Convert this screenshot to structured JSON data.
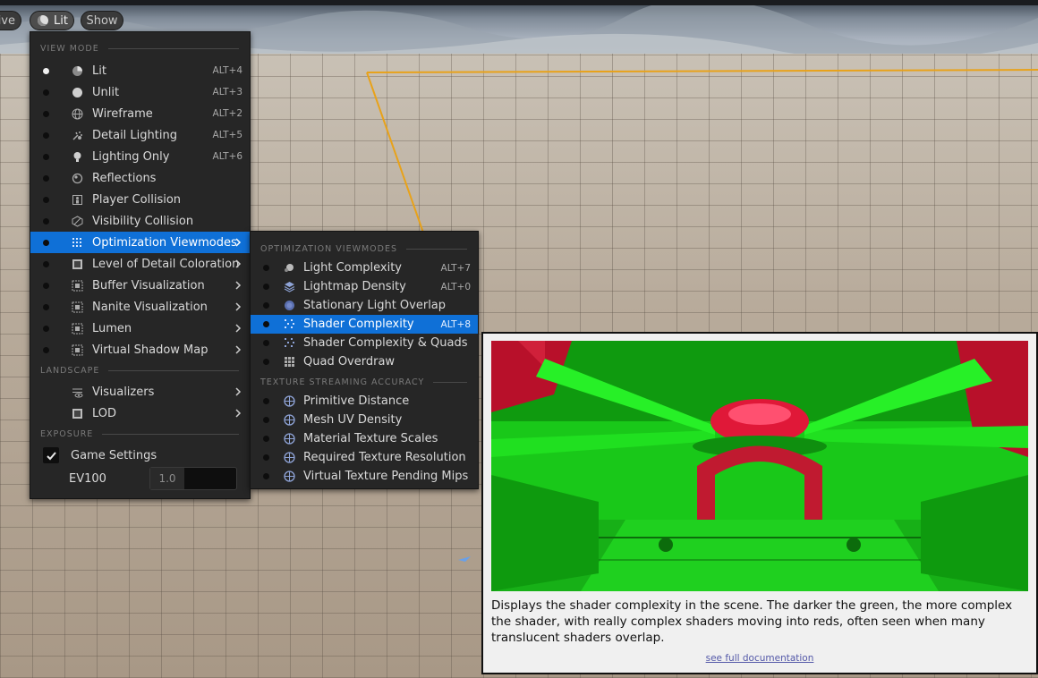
{
  "toolbar": {
    "perspective_label": "tive",
    "viewmode_label": "Lit",
    "show_label": "Show"
  },
  "main_menu": {
    "section_view_mode": "VIEW MODE",
    "items": [
      {
        "label": "Lit",
        "shortcut": "ALT+4",
        "icon": "lit-sphere-icon",
        "active": true
      },
      {
        "label": "Unlit",
        "shortcut": "ALT+3",
        "icon": "unlit-sphere-icon"
      },
      {
        "label": "Wireframe",
        "shortcut": "ALT+2",
        "icon": "wireframe-sphere-icon"
      },
      {
        "label": "Detail Lighting",
        "shortcut": "ALT+5",
        "icon": "detail-lighting-icon"
      },
      {
        "label": "Lighting Only",
        "shortcut": "ALT+6",
        "icon": "lightbulb-icon"
      },
      {
        "label": "Reflections",
        "shortcut": "",
        "icon": "reflections-icon"
      },
      {
        "label": "Player Collision",
        "shortcut": "",
        "icon": "player-collision-icon"
      },
      {
        "label": "Visibility Collision",
        "shortcut": "",
        "icon": "visibility-collision-icon"
      },
      {
        "label": "Optimization Viewmodes",
        "shortcut": "",
        "icon": "grid-dots-icon",
        "submenu": true,
        "selected": true
      },
      {
        "label": "Level of Detail Coloration",
        "shortcut": "",
        "icon": "lod-coloration-icon",
        "submenu": true
      },
      {
        "label": "Buffer Visualization",
        "shortcut": "",
        "icon": "buffer-icon",
        "submenu": true
      },
      {
        "label": "Nanite Visualization",
        "shortcut": "",
        "icon": "nanite-icon",
        "submenu": true
      },
      {
        "label": "Lumen",
        "shortcut": "",
        "icon": "lumen-icon",
        "submenu": true
      },
      {
        "label": "Virtual Shadow Map",
        "shortcut": "",
        "icon": "shadow-map-icon",
        "submenu": true
      }
    ],
    "section_landscape": "LANDSCAPE",
    "landscape_items": [
      {
        "label": "Visualizers",
        "icon": "visualizers-icon"
      },
      {
        "label": "LOD",
        "icon": "lod-icon"
      }
    ],
    "section_exposure": "EXPOSURE",
    "game_settings_label": "Game Settings",
    "game_settings_checked": true,
    "ev100_label": "EV100",
    "ev100_value": "1.0"
  },
  "sub_menu": {
    "section_optimization": "OPTIMIZATION VIEWMODES",
    "items": [
      {
        "label": "Light Complexity",
        "shortcut": "ALT+7",
        "icon": "light-complexity-icon"
      },
      {
        "label": "Lightmap Density",
        "shortcut": "ALT+0",
        "icon": "lightmap-density-icon"
      },
      {
        "label": "Stationary Light Overlap",
        "shortcut": "",
        "icon": "stationary-light-icon"
      },
      {
        "label": "Shader Complexity",
        "shortcut": "ALT+8",
        "icon": "shader-complexity-icon",
        "selected": true
      },
      {
        "label": "Shader Complexity & Quads",
        "shortcut": "",
        "icon": "shader-quads-icon"
      },
      {
        "label": "Quad Overdraw",
        "shortcut": "",
        "icon": "quad-overdraw-icon"
      }
    ],
    "section_texture": "TEXTURE STREAMING ACCURACY",
    "texture_items": [
      {
        "label": "Primitive Distance",
        "icon": "crosshair-icon"
      },
      {
        "label": "Mesh UV Density",
        "icon": "crosshair-icon"
      },
      {
        "label": "Material Texture Scales",
        "icon": "crosshair-icon"
      },
      {
        "label": "Required Texture Resolution",
        "icon": "crosshair-icon"
      },
      {
        "label": "Virtual Texture Pending Mips",
        "icon": "crosshair-icon"
      }
    ]
  },
  "tooltip": {
    "description": "Displays the shader complexity in the scene. The darker the green, the more complex the shader, with really complex shaders moving into reds, often seen when many translucent shaders overlap.",
    "link_text": "see full documentation"
  },
  "colors": {
    "menu_bg": "#262626",
    "selection_blue": "#0f70d7",
    "shader_green": "#18d018",
    "shader_red": "#c0102a",
    "selection_outline": "#e8a21a"
  }
}
